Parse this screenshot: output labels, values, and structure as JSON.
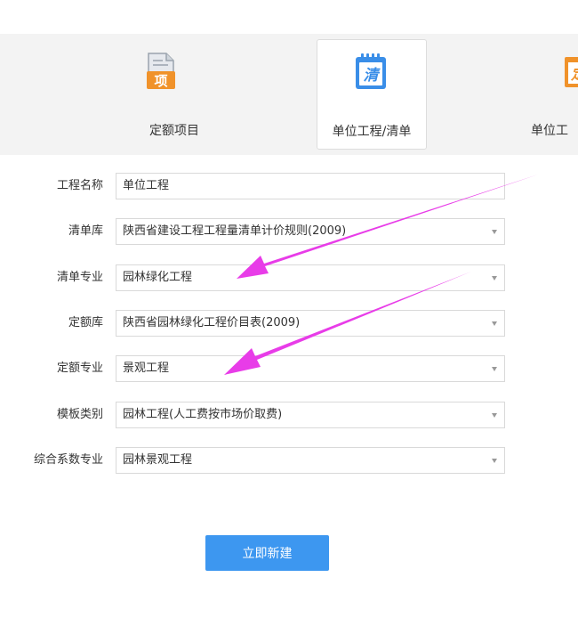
{
  "tabs": [
    {
      "label": "定额项目",
      "icon_text": "项",
      "icon": "document-icon"
    },
    {
      "label": "单位工程/清单",
      "icon_text": "清",
      "icon": "calendar-icon"
    },
    {
      "label": "单位工",
      "icon_text": "定",
      "icon": "document-icon"
    }
  ],
  "form": {
    "project_name": {
      "label": "工程名称",
      "value": "单位工程"
    },
    "list_library": {
      "label": "清单库",
      "value": "陕西省建设工程工程量清单计价规则(2009)"
    },
    "list_specialty": {
      "label": "清单专业",
      "value": "园林绿化工程"
    },
    "quota_library": {
      "label": "定额库",
      "value": "陕西省园林绿化工程价目表(2009)"
    },
    "quota_specialty": {
      "label": "定额专业",
      "value": "景观工程"
    },
    "template_type": {
      "label": "模板类别",
      "value": "园林工程(人工费按市场价取费)"
    },
    "coefficient_specialty": {
      "label": "综合系数专业",
      "value": "园林景观工程"
    }
  },
  "actions": {
    "create_label": "立即新建"
  },
  "colors": {
    "accent_blue": "#3d97f0",
    "icon_orange": "#f0922a",
    "icon_blue": "#3a8ee8",
    "annotation_magenta": "#e83ce8"
  }
}
